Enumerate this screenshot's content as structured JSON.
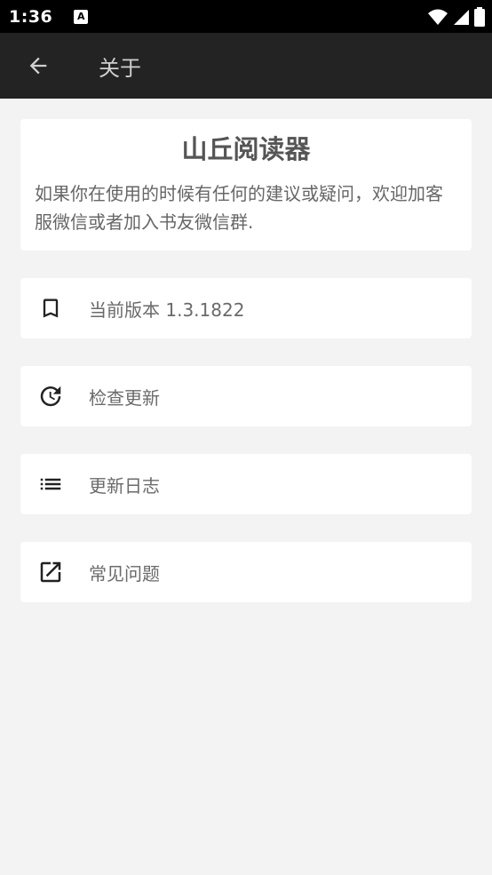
{
  "status_bar": {
    "time": "1:36",
    "notif_glyph": "A"
  },
  "app_bar": {
    "title": "关于",
    "back_icon": "arrow-left-icon"
  },
  "intro": {
    "app_name": "山丘阅读器",
    "description": "如果你在使用的时候有任何的建议或疑问，欢迎加客服微信或者加入书友微信群."
  },
  "rows": [
    {
      "label": "当前版本 1.3.1822",
      "icon": "bookmark-icon"
    },
    {
      "label": "检查更新",
      "icon": "update-clock-icon"
    },
    {
      "label": "更新日志",
      "icon": "list-icon"
    },
    {
      "label": "常见问题",
      "icon": "open-external-icon"
    }
  ],
  "colors": {
    "app_bar_bg": "#232323",
    "page_bg": "#f3f3f3",
    "card_bg": "#ffffff"
  }
}
